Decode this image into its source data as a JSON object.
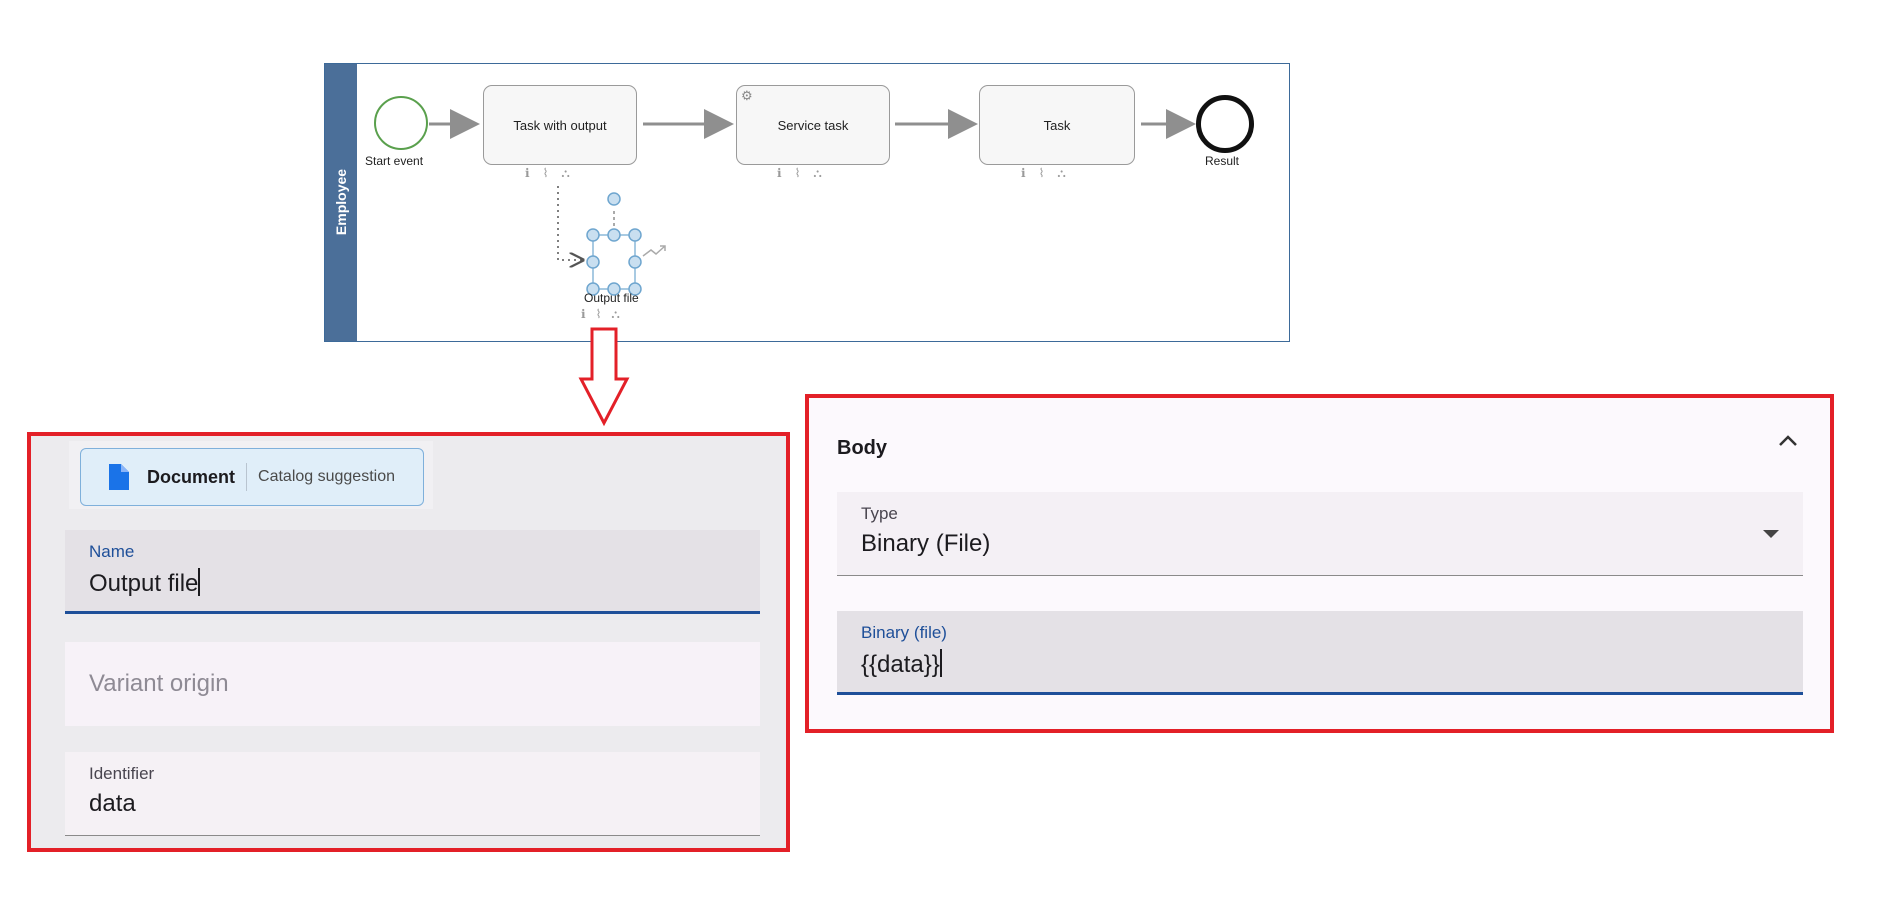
{
  "diagram": {
    "lane_label": "Employee",
    "start_event_label": "Start event",
    "tasks": [
      {
        "label": "Task with output"
      },
      {
        "label": "Service task"
      },
      {
        "label": "Task"
      }
    ],
    "end_event_label": "Result",
    "data_object_label": "Output file",
    "colors": {
      "lane": "#4b6f99",
      "start_event": "#5aa04d",
      "end_event": "#111111",
      "highlight": "#e32028"
    }
  },
  "left_panel": {
    "chip": {
      "title": "Document",
      "subtitle": "Catalog suggestion",
      "icon": "document-icon"
    },
    "name_field": {
      "label": "Name",
      "value": "Output file"
    },
    "variant_field": {
      "placeholder": "Variant origin"
    },
    "identifier_field": {
      "label": "Identifier",
      "value": "data"
    }
  },
  "right_panel": {
    "section_title": "Body",
    "type_field": {
      "label": "Type",
      "value": "Binary (File)"
    },
    "binary_field": {
      "label": "Binary (file)",
      "value": "{{data}}"
    }
  }
}
